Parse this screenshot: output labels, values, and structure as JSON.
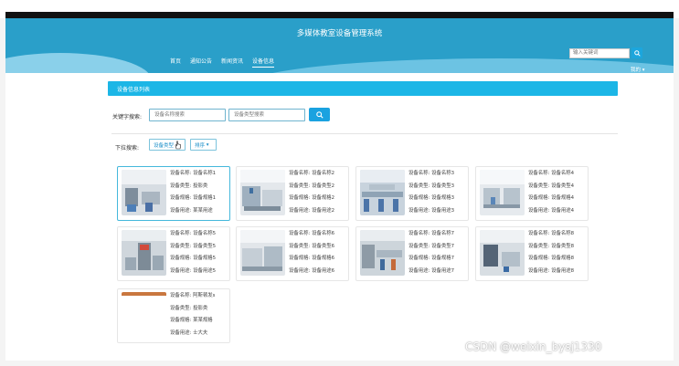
{
  "site": {
    "title": "多媒体教室设备管理系统"
  },
  "nav": [
    {
      "label": "首页"
    },
    {
      "label": "通知公告"
    },
    {
      "label": "新闻资讯"
    },
    {
      "label": "设备信息"
    }
  ],
  "top_search": {
    "placeholder": "输入关键词"
  },
  "user_menu": {
    "label": "我的"
  },
  "panel": {
    "title": "设备信息列表"
  },
  "search": {
    "label": "关键字搜索:",
    "name_placeholder": "设备名称搜索",
    "type_placeholder": "设备类型搜索"
  },
  "filters": {
    "label": "下拉搜索:",
    "type_label": "设备类型",
    "sort_label": "排序"
  },
  "devices": [
    {
      "name": "设备名称: 设备名称1",
      "type": "设备类型: 投影类",
      "spec": "设备规格: 设备规格1",
      "use": "设备用途: 某某用途"
    },
    {
      "name": "设备名称: 设备名称2",
      "type": "设备类型: 设备类型2",
      "spec": "设备规格: 设备规格2",
      "use": "设备用途: 设备用途2"
    },
    {
      "name": "设备名称: 设备名称3",
      "type": "设备类型: 设备类型3",
      "spec": "设备规格: 设备规格3",
      "use": "设备用途: 设备用途3"
    },
    {
      "name": "设备名称: 设备名称4",
      "type": "设备类型: 设备类型4",
      "spec": "设备规格: 设备规格4",
      "use": "设备用途: 设备用途4"
    },
    {
      "name": "设备名称: 设备名称5",
      "type": "设备类型: 设备类型5",
      "spec": "设备规格: 设备规格5",
      "use": "设备用途: 设备用途5"
    },
    {
      "name": "设备名称: 设备名称6",
      "type": "设备类型: 设备类型6",
      "spec": "设备规格: 设备规格6",
      "use": "设备用途: 设备用途6"
    },
    {
      "name": "设备名称: 设备名称7",
      "type": "设备类型: 设备类型7",
      "spec": "设备规格: 设备规格7",
      "use": "设备用途: 设备用途7"
    },
    {
      "name": "设备名称: 设备名称8",
      "type": "设备类型: 设备类型8",
      "spec": "设备规格: 设备规格8",
      "use": "设备用途: 设备用途8"
    },
    {
      "name": "设备名称: 阿斯顿发s",
      "type": "设备类型: 投影类",
      "spec": "设备规格: 某某规格",
      "use": "设备用途: 士大夫"
    }
  ],
  "watermark": "CSDN @weixin_bysj1330"
}
